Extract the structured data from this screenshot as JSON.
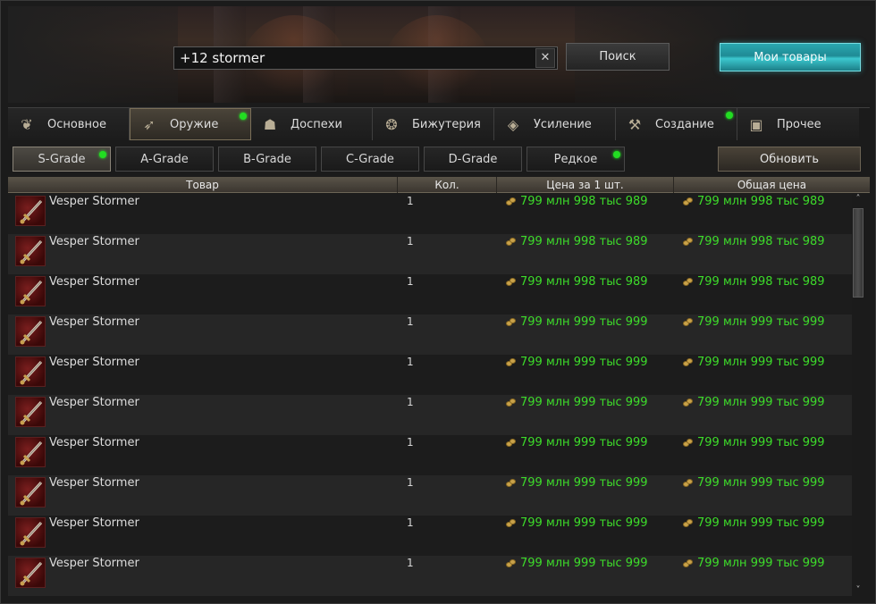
{
  "search": {
    "value": "+12 stormer",
    "clear_label": "✕",
    "button_label": "Поиск"
  },
  "my_items_label": "Мои товары",
  "tabs": [
    {
      "label": "Основное",
      "icon": "coins-icon",
      "glyph": "❦",
      "active": false,
      "dot": false
    },
    {
      "label": "Оружие",
      "icon": "bow-icon",
      "glyph": "➶",
      "active": true,
      "dot": true
    },
    {
      "label": "Доспехи",
      "icon": "helmet-icon",
      "glyph": "☗",
      "active": false,
      "dot": false
    },
    {
      "label": "Бижутерия",
      "icon": "jewelry-icon",
      "glyph": "❂",
      "active": false,
      "dot": false
    },
    {
      "label": "Усиление",
      "icon": "crystal-icon",
      "glyph": "◈",
      "active": false,
      "dot": false
    },
    {
      "label": "Создание",
      "icon": "anvil-icon",
      "glyph": "⚒",
      "active": false,
      "dot": true
    },
    {
      "label": "Прочее",
      "icon": "chest-icon",
      "glyph": "▣",
      "active": false,
      "dot": false
    }
  ],
  "grades": [
    {
      "label": "S-Grade",
      "active": true,
      "dot": true
    },
    {
      "label": "A-Grade",
      "active": false,
      "dot": false
    },
    {
      "label": "B-Grade",
      "active": false,
      "dot": false
    },
    {
      "label": "C-Grade",
      "active": false,
      "dot": false
    },
    {
      "label": "D-Grade",
      "active": false,
      "dot": false
    },
    {
      "label": "Редкое",
      "active": false,
      "dot": true
    }
  ],
  "refresh_label": "Обновить",
  "columns": [
    "Товар",
    "Кол.",
    "Цена за 1 шт.",
    "Общая цена"
  ],
  "rows": [
    {
      "name": "Vesper Stormer",
      "qty": "1",
      "unit_price": "799 млн 998 тыс 989",
      "total_price": "799 млн 998 тыс 989"
    },
    {
      "name": "Vesper Stormer",
      "qty": "1",
      "unit_price": "799 млн 998 тыс 989",
      "total_price": "799 млн 998 тыс 989"
    },
    {
      "name": "Vesper Stormer",
      "qty": "1",
      "unit_price": "799 млн 998 тыс 989",
      "total_price": "799 млн 998 тыс 989"
    },
    {
      "name": "Vesper Stormer",
      "qty": "1",
      "unit_price": "799 млн 999 тыс 999",
      "total_price": "799 млн 999 тыс 999"
    },
    {
      "name": "Vesper Stormer",
      "qty": "1",
      "unit_price": "799 млн 999 тыс 999",
      "total_price": "799 млн 999 тыс 999"
    },
    {
      "name": "Vesper Stormer",
      "qty": "1",
      "unit_price": "799 млн 999 тыс 999",
      "total_price": "799 млн 999 тыс 999"
    },
    {
      "name": "Vesper Stormer",
      "qty": "1",
      "unit_price": "799 млн 999 тыс 999",
      "total_price": "799 млн 999 тыс 999"
    },
    {
      "name": "Vesper Stormer",
      "qty": "1",
      "unit_price": "799 млн 999 тыс 999",
      "total_price": "799 млн 999 тыс 999"
    },
    {
      "name": "Vesper Stormer",
      "qty": "1",
      "unit_price": "799 млн 999 тыс 999",
      "total_price": "799 млн 999 тыс 999"
    },
    {
      "name": "Vesper Stormer",
      "qty": "1",
      "unit_price": "799 млн 999 тыс 999",
      "total_price": "799 млн 999 тыс 999"
    }
  ],
  "colors": {
    "price": "#3ddc2a",
    "accent": "#2aa7b0",
    "new_dot": "#22dd22"
  }
}
